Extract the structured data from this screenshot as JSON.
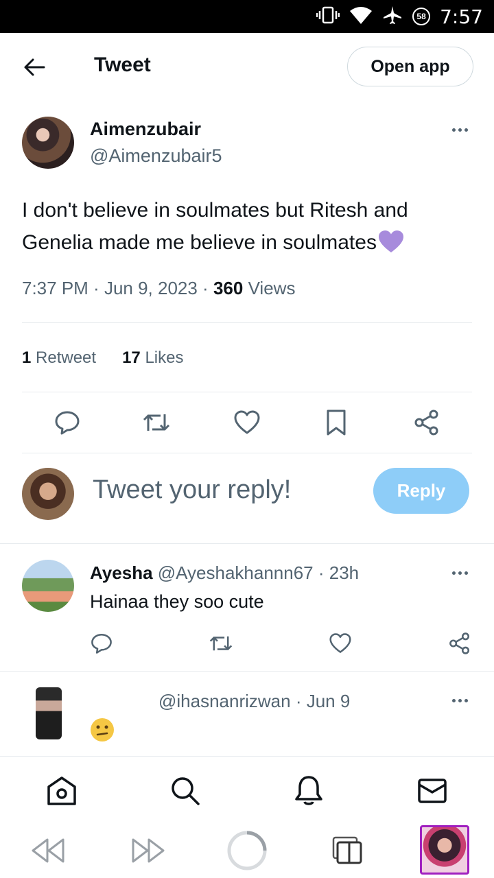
{
  "status_bar": {
    "time": "7:57",
    "battery": "58"
  },
  "header": {
    "title": "Tweet",
    "open_app": "Open app"
  },
  "tweet": {
    "author_name": "Aimenzubair",
    "author_handle": "@Aimenzubair5",
    "text": "I don't believe in soulmates but Ritesh and Genelia made me believe in soulmates",
    "emoji": "purple-heart",
    "time": "7:37 PM",
    "date": "Jun 9, 2023",
    "views_count": "360",
    "views_label": "Views",
    "retweets_count": "1",
    "retweets_label": "Retweet",
    "likes_count": "17",
    "likes_label": "Likes"
  },
  "compose": {
    "placeholder": "Tweet your reply!",
    "button": "Reply"
  },
  "replies": [
    {
      "name": "Ayesha",
      "handle": "@Ayeshakhannn67",
      "time": "23h",
      "text": "Hainaa they soo cute"
    },
    {
      "name": "",
      "handle": "@ihasnanrizwan",
      "time": "Jun 9",
      "text": "",
      "emoji": "confused-face"
    }
  ],
  "colors": {
    "accent": "#1d9bf0",
    "reply_button": "#8ecdf8",
    "muted": "#536471",
    "heart": "#a78bdc"
  }
}
